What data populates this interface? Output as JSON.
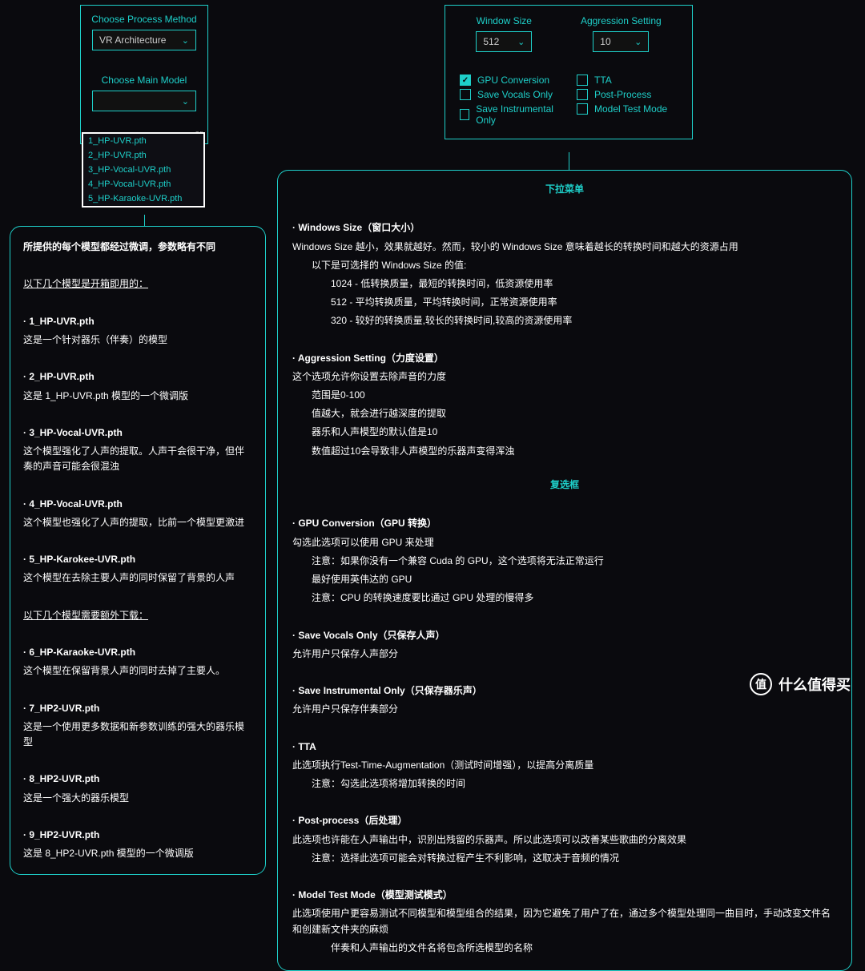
{
  "left_panel": {
    "process_label": "Choose Process Method",
    "process_value": "VR Architecture",
    "model_label": "Choose Main Model",
    "model_value": "",
    "dropdown_items": [
      "1_HP-UVR.pth",
      "2_HP-UVR.pth",
      "3_HP-Vocal-UVR.pth",
      "4_HP-Vocal-UVR.pth",
      "5_HP-Karaoke-UVR.pth"
    ],
    "overflow_hint": "er"
  },
  "right_panel": {
    "window_size_label": "Window Size",
    "window_size_value": "512",
    "aggression_label": "Aggression Setting",
    "aggression_value": "10",
    "checks_left": [
      {
        "label": "GPU Conversion",
        "checked": true
      },
      {
        "label": "Save Vocals Only",
        "checked": false
      },
      {
        "label": "Save Instrumental Only",
        "checked": false
      }
    ],
    "checks_right": [
      {
        "label": "TTA",
        "checked": false
      },
      {
        "label": "Post-Process",
        "checked": false
      },
      {
        "label": "Model Test Mode",
        "checked": false
      }
    ]
  },
  "left_explain": {
    "intro": "所提供的每个模型都经过微调，参数略有不同",
    "ready_header": "以下几个模型是开箱即用的：",
    "models_ready": [
      {
        "name": "· 1_HP-UVR.pth",
        "desc": "这是一个针对器乐（伴奏）的模型"
      },
      {
        "name": "· 2_HP-UVR.pth",
        "desc": "这是 1_HP-UVR.pth 模型的一个微调版"
      },
      {
        "name": "· 3_HP-Vocal-UVR.pth",
        "desc": "这个模型强化了人声的提取。人声干会很干净，但伴奏的声音可能会很混浊"
      },
      {
        "name": "· 4_HP-Vocal-UVR.pth",
        "desc": "这个模型也强化了人声的提取，比前一个模型更激进"
      },
      {
        "name": "· 5_HP-Karokee-UVR.pth",
        "desc": "这个模型在去除主要人声的同时保留了背景的人声"
      }
    ],
    "download_header": "以下几个模型需要额外下载：",
    "models_download": [
      {
        "name": "· 6_HP-Karaoke-UVR.pth",
        "desc": "这个模型在保留背景人声的同时去掉了主要人。"
      },
      {
        "name": "· 7_HP2-UVR.pth",
        "desc": "这是一个使用更多数据和新参数训练的强大的器乐模型"
      },
      {
        "name": "· 8_HP2-UVR.pth",
        "desc": "这是一个强大的器乐模型"
      },
      {
        "name": "· 9_HP2-UVR.pth",
        "desc": "这是 8_HP2-UVR.pth 模型的一个微调版"
      }
    ]
  },
  "right_explain": {
    "dropdown_header": "下拉菜单",
    "ws_title": "· Windows Size（窗口大小）",
    "ws_line1": "Windows Size 越小，效果就越好。然而，较小的 Windows Size 意味着越长的转换时间和越大的资源占用",
    "ws_line2": "以下是可选择的 Windows Size 的值:",
    "ws_opt1": "1024 - 低转换质量，最短的转换时间，低资源使用率",
    "ws_opt2": "512 - 平均转换质量，平均转换时间，正常资源使用率",
    "ws_opt3": "320 - 较好的转换质量,较长的转换时间,较高的资源使用率",
    "ag_title": "· Aggression Setting（力度设置）",
    "ag_line1": "这个选项允许你设置去除声音的力度",
    "ag_opt1": "范围是0-100",
    "ag_opt2": "值越大，就会进行越深度的提取",
    "ag_opt3": "器乐和人声模型的默认值是10",
    "ag_opt4": "数值超过10会导致非人声模型的乐器声变得浑浊",
    "checkbox_header": "复选框",
    "gpu_title": "· GPU Conversion（GPU 转换）",
    "gpu_line1": "勾选此选项可以使用 GPU 来处理",
    "gpu_opt1": "注意：如果你没有一个兼容 Cuda 的 GPU，这个选项将无法正常运行",
    "gpu_opt2": "最好使用英伟达的 GPU",
    "gpu_opt3": "注意：CPU 的转换速度要比通过 GPU 处理的慢得多",
    "svo_title": "· Save Vocals Only（只保存人声）",
    "svo_line1": "允许用户只保存人声部分",
    "sio_title": "· Save Instrumental Only（只保存器乐声）",
    "sio_line1": "允许用户只保存伴奏部分",
    "tta_title": "· TTA",
    "tta_line1": "此选项执行Test-Time-Augmentation（测试时间增强），以提高分离质量",
    "tta_opt1": "注意：勾选此选项将增加转换的时间",
    "pp_title": "· Post-process（后处理）",
    "pp_line1": "此选项也许能在人声输出中，识别出残留的乐器声。所以此选项可以改善某些歌曲的分离效果",
    "pp_opt1": "注意：选择此选项可能会对转换过程产生不利影响，这取决于音频的情况",
    "mtm_title": "· Model Test Mode（模型测试模式）",
    "mtm_line1": "此选项使用户更容易测试不同模型和模型组合的结果，因为它避免了用户了在，通过多个模型处理同一曲目时，手动改变文件名和创建新文件夹的麻烦",
    "mtm_opt1": "伴奏和人声输出的文件名将包含所选模型的名称"
  },
  "watermark": {
    "glyph": "值",
    "text": "什么值得买"
  }
}
